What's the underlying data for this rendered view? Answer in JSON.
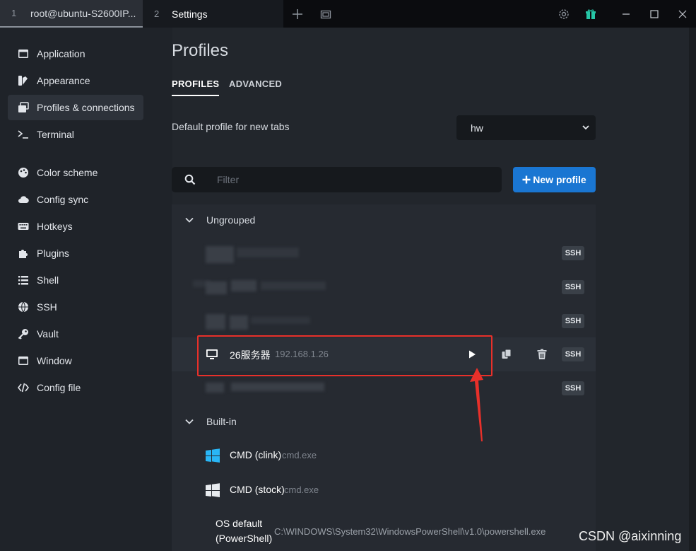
{
  "tabs": [
    {
      "num": "1",
      "label": "root@ubuntu-S2600IP..."
    },
    {
      "num": "2",
      "label": "Settings"
    }
  ],
  "sidebar": {
    "items": [
      {
        "label": "Application",
        "icon": "window-icon"
      },
      {
        "label": "Appearance",
        "icon": "palette-icon"
      },
      {
        "label": "Profiles & connections",
        "icon": "windows-stack-icon",
        "active": true
      },
      {
        "label": "Terminal",
        "icon": "terminal-prompt-icon"
      },
      {
        "label": "Color scheme",
        "icon": "palette-icon"
      },
      {
        "label": "Config sync",
        "icon": "cloud-icon"
      },
      {
        "label": "Hotkeys",
        "icon": "keyboard-icon"
      },
      {
        "label": "Plugins",
        "icon": "puzzle-icon"
      },
      {
        "label": "Shell",
        "icon": "list-icon"
      },
      {
        "label": "SSH",
        "icon": "globe-icon"
      },
      {
        "label": "Vault",
        "icon": "key-icon"
      },
      {
        "label": "Window",
        "icon": "window-icon"
      },
      {
        "label": "Config file",
        "icon": "code-icon"
      }
    ]
  },
  "main": {
    "title": "Profiles",
    "subtabs": [
      "PROFILES",
      "ADVANCED"
    ],
    "default_profile_label": "Default profile for new tabs",
    "default_profile_value": "hw",
    "filter_placeholder": "Filter",
    "new_profile_label": "New profile",
    "groups": {
      "ungrouped": "Ungrouped",
      "builtin": "Built-in"
    },
    "ungrouped_rows": [
      {
        "badge": "SSH"
      },
      {
        "badge": "SSH"
      },
      {
        "badge": "SSH"
      },
      {
        "name": "26服务器",
        "host": "192.168.1.26",
        "badge": "SSH"
      },
      {
        "badge": "SSH"
      }
    ],
    "builtin_rows": [
      {
        "name": "CMD (clink)",
        "sub": "cmd.exe"
      },
      {
        "name": "CMD (stock)",
        "sub": "cmd.exe"
      }
    ],
    "os_default": {
      "line1": "OS default",
      "line2": "(PowerShell)",
      "path": "C:\\WINDOWS\\System32\\WindowsPowerShell\\v1.0\\powershell.exe"
    }
  },
  "watermark": "CSDN @aixinning",
  "colors": {
    "accent": "#1a76d2",
    "annotation": "#e8302a",
    "windows": "#29b6f6"
  }
}
